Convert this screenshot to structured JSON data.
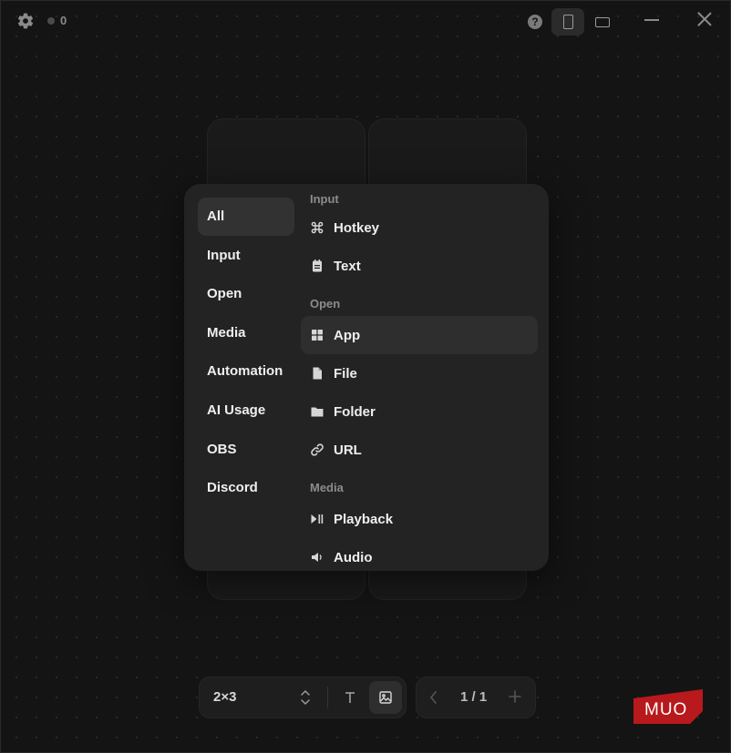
{
  "topbar": {
    "connection_count": "0",
    "help_label": "?"
  },
  "categories": [
    {
      "label": "All",
      "active": true
    },
    {
      "label": "Input"
    },
    {
      "label": "Open"
    },
    {
      "label": "Media"
    },
    {
      "label": "Automation"
    },
    {
      "label": "AI Usage"
    },
    {
      "label": "OBS"
    },
    {
      "label": "Discord"
    }
  ],
  "sections": {
    "input": {
      "label": "Input",
      "items": [
        {
          "label": "Hotkey",
          "icon": "command-icon"
        },
        {
          "label": "Text",
          "icon": "notepad-icon"
        }
      ]
    },
    "open": {
      "label": "Open",
      "items": [
        {
          "label": "App",
          "icon": "app-grid-icon",
          "active": true
        },
        {
          "label": "File",
          "icon": "file-icon"
        },
        {
          "label": "Folder",
          "icon": "folder-icon"
        },
        {
          "label": "URL",
          "icon": "link-icon"
        }
      ]
    },
    "media": {
      "label": "Media",
      "items": [
        {
          "label": "Playback",
          "icon": "play-pause-icon"
        },
        {
          "label": "Audio",
          "icon": "speaker-icon"
        }
      ]
    }
  },
  "toolbar": {
    "layout": "2×3",
    "page_indicator": "1 / 1"
  },
  "watermark": {
    "text": "MUO",
    "color": "#b8191c"
  },
  "colors": {
    "background": "#141414",
    "popup": "#232323",
    "active_row": "#323232"
  }
}
